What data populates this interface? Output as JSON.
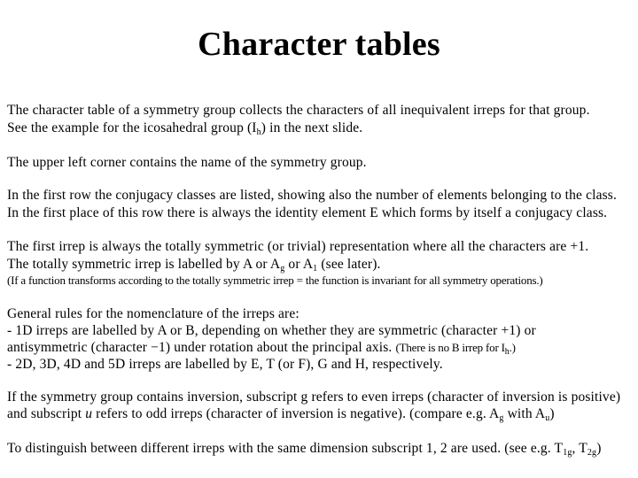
{
  "title": "Character tables",
  "p1": {
    "line1": "The character table of a symmetry group collects the characters of all inequivalent irreps for that group.",
    "line2_pre": "See the example for the icosahedral group (I",
    "line2_sub": "h",
    "line2_post": ") in the next slide."
  },
  "p2": {
    "line1": "The upper left corner contains the name of the symmetry group."
  },
  "p3": {
    "line1": "In the first row the conjugacy classes are listed, showing also the number of elements belonging to the class.",
    "line2": "In the first place of this row there is always the identity element E which forms by itself a conjugacy class."
  },
  "p4": {
    "line1": "The first irrep is always the totally symmetric (or trivial) representation where all the characters are +1.",
    "line2_pre": "The totally symmetric irrep is labelled by A or A",
    "line2_sub1": "g",
    "line2_mid": " or A",
    "line2_sub2": "1",
    "line2_post": " (see later).",
    "line3": "(If a function transforms according to the totally symmetric irrep = the function is invariant for all symmetry operations.)"
  },
  "p5": {
    "line1": "General rules for the nomenclature of the irreps are:",
    "line2": "- 1D irreps are labelled by A or B, depending on whether they are symmetric (character +1) or",
    "line3_pre": "antisymmetric (character −1) under rotation about the principal axis. ",
    "line3_small_pre": "(There is no B irrep for I",
    "line3_small_sub": "h",
    "line3_small_post": ".)",
    "line4": "- 2D, 3D, 4D and 5D irreps are labelled by E, T (or F), G and H, respectively."
  },
  "p6": {
    "line1_pre": "If the symmetry group contains inversion, subscript ",
    "line1_g": "g",
    "line1_post": " refers to even irreps (character of inversion is positive)",
    "line2_pre": "and subscript ",
    "line2_u": "u",
    "line2_mid": " refers to odd irreps (character of inversion is negative). (compare e.g. A",
    "line2_sub1": "g",
    "line2_mid2": " with  A",
    "line2_sub2": "u",
    "line2_post": ")"
  },
  "p7": {
    "line1_pre": "To distinguish between different irreps with the same dimension subscript 1, 2 are used. (see e.g. T",
    "line1_sub1": "1g",
    "line1_mid": ", T",
    "line1_sub2": "2g",
    "line1_post": ")"
  }
}
